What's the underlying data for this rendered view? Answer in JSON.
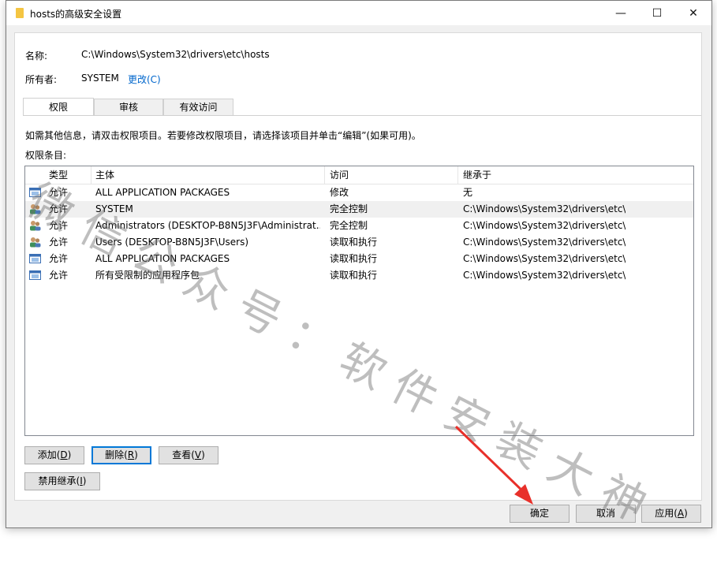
{
  "window": {
    "title": "hosts的高级安全设置",
    "controls": {
      "minimize": "—",
      "maximize": "☐",
      "close": "✕"
    }
  },
  "info": {
    "name_label": "名称:",
    "name_value": "C:\\Windows\\System32\\drivers\\etc\\hosts",
    "owner_label": "所有者:",
    "owner_value": "SYSTEM",
    "change_link": "更改(C)"
  },
  "tabs": [
    {
      "label": "权限",
      "active": true
    },
    {
      "label": "审核",
      "active": false
    },
    {
      "label": "有效访问",
      "active": false
    }
  ],
  "instructions": "如需其他信息，请双击权限项目。若要修改权限项目，请选择该项目并单击“编辑”(如果可用)。",
  "entries_label": "权限条目:",
  "table": {
    "headers": [
      "类型",
      "主体",
      "访问",
      "继承于"
    ],
    "rows": [
      {
        "icon": "package-icon",
        "type": "允许",
        "principal": "ALL APPLICATION PACKAGES",
        "access": "修改",
        "inherited": "无",
        "selected": false
      },
      {
        "icon": "users-icon",
        "type": "允许",
        "principal": "SYSTEM",
        "access": "完全控制",
        "inherited": "C:\\Windows\\System32\\drivers\\etc\\",
        "selected": true
      },
      {
        "icon": "users-icon",
        "type": "允许",
        "principal": "Administrators (DESKTOP-B8N5J3F\\Administrat...",
        "access": "完全控制",
        "inherited": "C:\\Windows\\System32\\drivers\\etc\\",
        "selected": false
      },
      {
        "icon": "users-icon",
        "type": "允许",
        "principal": "Users (DESKTOP-B8N5J3F\\Users)",
        "access": "读取和执行",
        "inherited": "C:\\Windows\\System32\\drivers\\etc\\",
        "selected": false
      },
      {
        "icon": "package-icon",
        "type": "允许",
        "principal": "ALL APPLICATION PACKAGES",
        "access": "读取和执行",
        "inherited": "C:\\Windows\\System32\\drivers\\etc\\",
        "selected": false
      },
      {
        "icon": "package-icon",
        "type": "允许",
        "principal": "所有受限制的应用程序包",
        "access": "读取和执行",
        "inherited": "C:\\Windows\\System32\\drivers\\etc\\",
        "selected": false
      }
    ]
  },
  "buttons": {
    "add": {
      "text": "添加(",
      "key": "D",
      "end": ")"
    },
    "remove": {
      "text": "删除(",
      "key": "R",
      "end": ")"
    },
    "view": {
      "text": "查看(",
      "key": "V",
      "end": ")"
    },
    "disable_inheritance": {
      "text": "禁用继承(",
      "key": "I",
      "end": ")"
    },
    "ok": "确定",
    "cancel": "取消",
    "apply": {
      "text": "应用(",
      "key": "A",
      "end": ")"
    }
  },
  "watermark": "微信公众号：软件安装大神",
  "colors": {
    "link": "#0066cc",
    "arrow": "#e8302a",
    "selection": "#f0f0f0",
    "focus": "#0078d7"
  }
}
